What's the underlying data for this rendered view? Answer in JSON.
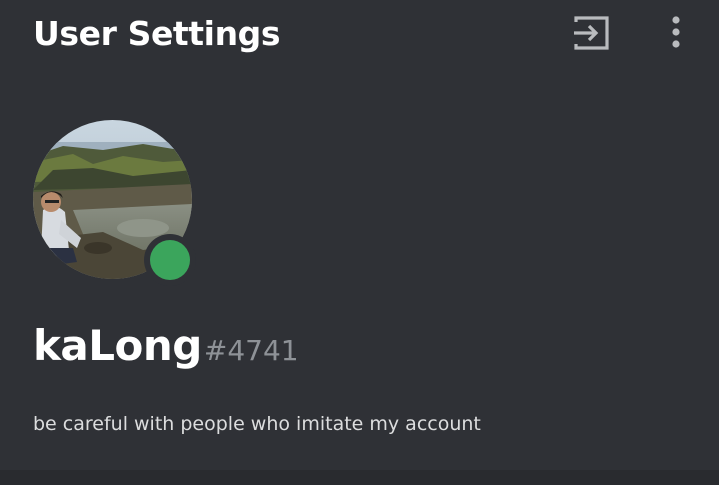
{
  "header": {
    "title": "User Settings",
    "logout_icon": "logout-icon",
    "more_icon": "more-vertical-icon"
  },
  "profile": {
    "username": "kaLong",
    "discriminator": "#4741",
    "bio": "be careful with people who imitate my account",
    "status": "online",
    "status_color": "#3ba55c"
  },
  "colors": {
    "background": "#2f3136",
    "header_icon": "#b9bbbe"
  }
}
